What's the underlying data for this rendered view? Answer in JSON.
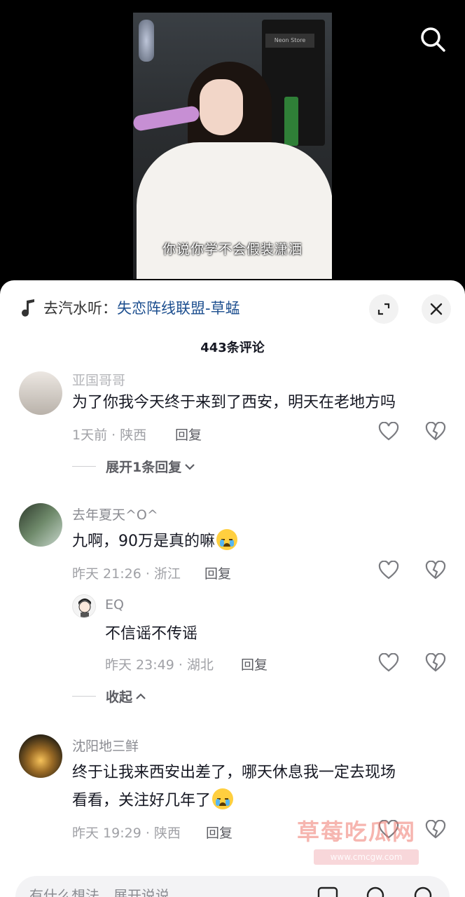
{
  "video": {
    "caption": "你说你学不会假装潇洒",
    "store_sign": "Neon Store"
  },
  "sheet": {
    "music_prefix": "去汽水听：",
    "music_title": "失恋阵线联盟-草蜢",
    "comment_count": "443条评论"
  },
  "comments": [
    {
      "name": "亚国哥哥",
      "text": "为了你我今天终于来到了西安，明天在老地方吗",
      "meta": "1天前 · 陕西",
      "reply_label": "回复",
      "toggle": "展开1条回复"
    },
    {
      "name": "去年夏天^O^",
      "text": "九啊，90万是真的嘛",
      "meta": "昨天 21:26 · 浙江",
      "reply_label": "回复",
      "reply": {
        "name": "EQ",
        "text": "不信谣不传谣",
        "meta": "昨天 23:49 · 湖北",
        "reply_label": "回复"
      },
      "toggle": "收起"
    },
    {
      "name": "沈阳地三鲜",
      "text_line1": "终于让我来西安出差了，哪天休息我一定去现场",
      "text_line2": "看看，关注好几年了",
      "meta": "昨天 19:29 · 陕西",
      "reply_label": "回复"
    }
  ],
  "watermark": {
    "text": "草莓吃瓜网",
    "url": "www.cmcgw.com"
  },
  "input": {
    "placeholder": "有什么想法，展开说说"
  },
  "icons": {
    "search": "search-icon",
    "music": "music-note-icon",
    "expand": "expand-icon",
    "close": "close-icon",
    "like": "heart-icon",
    "dislike": "broken-heart-icon"
  }
}
